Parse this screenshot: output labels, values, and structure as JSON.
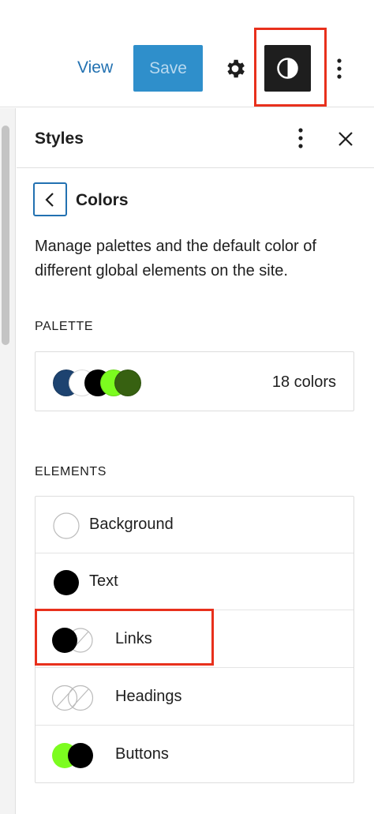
{
  "toolbar": {
    "view_label": "View",
    "save_label": "Save"
  },
  "panel": {
    "title": "Styles",
    "section_title": "Colors",
    "description": "Manage palettes and the default color of different global elements on the site."
  },
  "palette": {
    "label": "PALETTE",
    "count": "18 colors",
    "swatch_colors": [
      "#1d4370",
      "#ffffff",
      "#000000",
      "#7cfc1f",
      "#376111"
    ]
  },
  "elements": {
    "label": "ELEMENTS",
    "items": [
      {
        "label": "Background",
        "icon": "background-swatch-icon"
      },
      {
        "label": "Text",
        "icon": "text-swatch-icon"
      },
      {
        "label": "Links",
        "icon": "links-swatch-icon"
      },
      {
        "label": "Headings",
        "icon": "headings-swatch-icon"
      },
      {
        "label": "Buttons",
        "icon": "buttons-swatch-icon"
      }
    ]
  },
  "colors": {
    "accent": "#2271b1",
    "save_bg": "#2f8fcb",
    "highlight": "#e8301c",
    "button_green": "#7cfc1f"
  }
}
